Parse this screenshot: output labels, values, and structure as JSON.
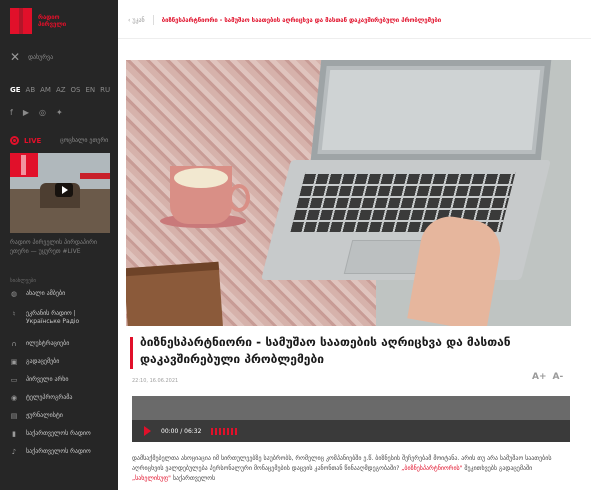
{
  "brand": {
    "logo_text_line1": "რადიო",
    "logo_text_line2": "პირველი"
  },
  "sidebar": {
    "close_label": "დახურვა",
    "languages": [
      {
        "code": "GE",
        "active": true
      },
      {
        "code": "AB",
        "active": false
      },
      {
        "code": "AM",
        "active": false
      },
      {
        "code": "AZ",
        "active": false
      },
      {
        "code": "OS",
        "active": false
      },
      {
        "code": "EN",
        "active": false
      },
      {
        "code": "RU",
        "active": false
      }
    ],
    "socials": [
      "facebook-icon",
      "youtube-icon",
      "instagram-icon",
      "twitter-icon"
    ],
    "live_label": "LIVE",
    "live_sub": "ცოცხალი ეთერი",
    "video_caption": "რადიო პირველის პირდაპირი ეთერი — უყურეთ #LIVE",
    "section_label": "სიახლეები",
    "menu": [
      {
        "icon": "globe-icon",
        "label": "ახალი ამბები"
      },
      {
        "icon": "microphone-icon",
        "label": "ეკრანის რადიო | Українське Радіо"
      },
      {
        "icon": "headphones-icon",
        "label": "ილუსტრაციები"
      },
      {
        "icon": "image-icon",
        "label": "გადაცემები"
      },
      {
        "icon": "film-icon",
        "label": "პირველი არხი"
      },
      {
        "icon": "podcast-icon",
        "label": "ტელეპროგრამა"
      },
      {
        "icon": "book-icon",
        "label": "ჟურნალისტი"
      },
      {
        "icon": "radio-icon",
        "label": "საქართველოს რადიო"
      },
      {
        "icon": "music-icon",
        "label": "საქართველოს რადიო"
      }
    ]
  },
  "breadcrumb": {
    "back_label": "უკან",
    "path": "ბიზნესპარტნიორი - სამუშაო საათების აღრიცხვა და მასთან დაკავშირებული პრობლემები"
  },
  "article": {
    "title": "ბიზნესპარტნიორი - სამუშაო საათების აღრიცხვა და მასთან დაკავშირებული პრობლემები",
    "date": "22:10, 16.06.2021",
    "font_controls": [
      "A+",
      "A-"
    ],
    "player": {
      "time": "00:00 / 06:32"
    },
    "body_part1": "დამსაქმებელთა ასოციაცია იმ სირთულეებზე საუბრობს, რომელიც კომპანიებში ე.წ. ბიზნესის შეჩერებამ მოიტანა. არის თუ არა სამუშაო საათების აღრიცხვის ვალდებულება პერსონალური მონაცემების დაცვის კანონთან წინააღმდეგობაში? ",
    "body_link1": "„ბიზნესპარტნიორის\"",
    "body_part2": " შეკითხვებს გადაცემაში ",
    "body_link2": "„სახელისუფ\"",
    "body_part3": " საქართველოს"
  },
  "colors": {
    "accent": "#e1102a",
    "sidebar_bg": "#262626"
  }
}
